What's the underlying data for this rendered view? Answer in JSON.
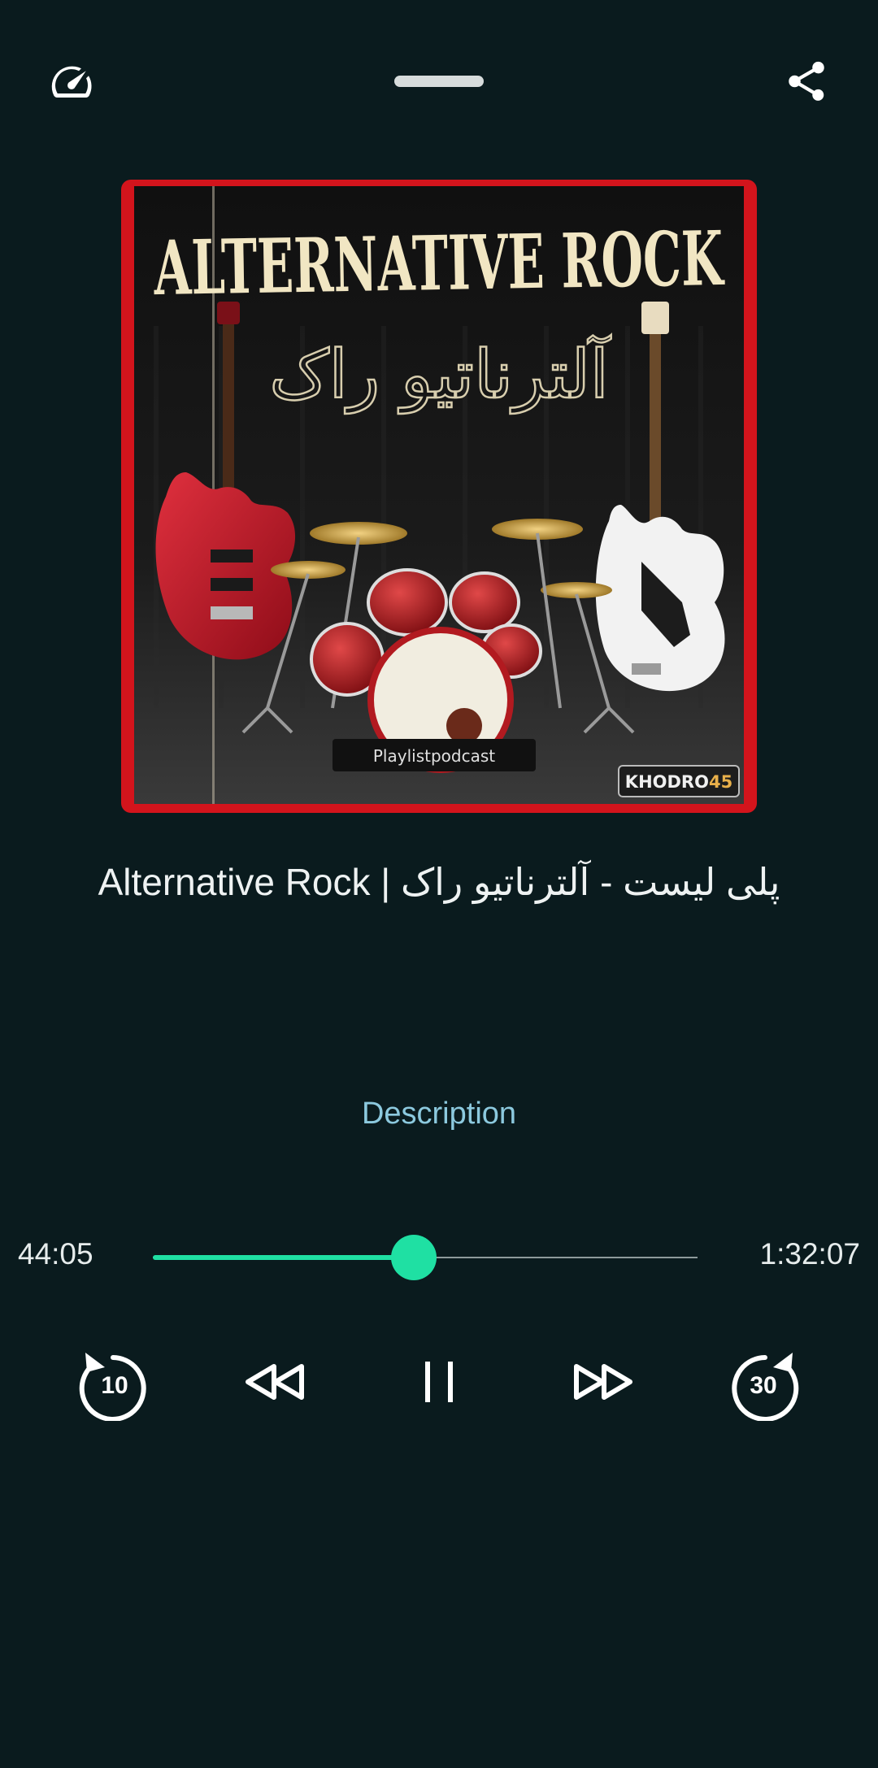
{
  "player": {
    "track_title": "Alternative Rock | پلی لیست - آلترناتیو راک",
    "description_label": "Description",
    "elapsed": "44:05",
    "duration": "1:32:07",
    "progress_fraction": 0.4785,
    "rewind_seconds": "10",
    "forward_seconds": "30"
  },
  "artwork": {
    "title_text": "ALTERNATIVE ROCK",
    "subtitle_text": "آلترناتیو راک",
    "tag_text": "Playlistpodcast",
    "brand_text": "KHODRO",
    "brand_number": "45"
  },
  "icons": {
    "speed": "speedometer-icon",
    "share": "share-icon",
    "replay": "replay-10-icon",
    "rewind": "rewind-icon",
    "pause": "pause-icon",
    "fast_forward": "fast-forward-icon",
    "forward": "forward-30-icon"
  },
  "colors": {
    "background": "#0a1b1e",
    "accent": "#1fe0a3",
    "link": "#8cc9de",
    "artwork_frame": "#d3141c"
  }
}
